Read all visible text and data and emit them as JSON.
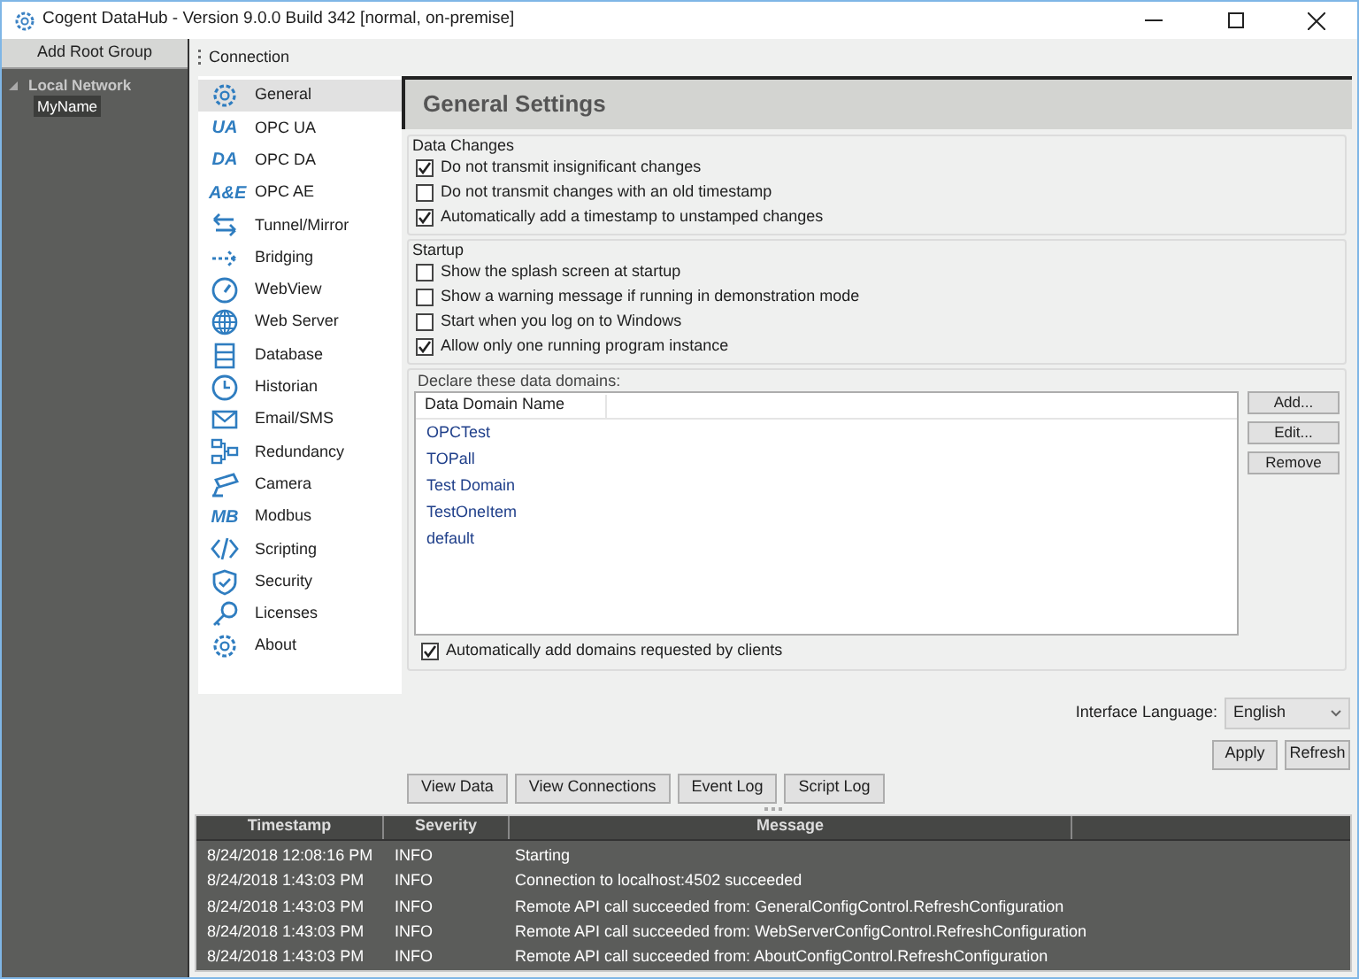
{
  "window": {
    "title": "Cogent DataHub - Version 9.0.0 Build 342 [normal, on-premise]"
  },
  "tree_panel": {
    "add_button": "Add Root Group",
    "nodes": [
      {
        "label": "Local Network",
        "expanded": true,
        "children": [
          {
            "label": "MyName",
            "selected": true
          }
        ]
      }
    ]
  },
  "toolbar": {
    "label": "Connection"
  },
  "nav": [
    {
      "label": "General",
      "kind": "gear",
      "selected": true
    },
    {
      "label": "OPC UA",
      "kind": "text",
      "icon_text": "UA",
      "selected": false
    },
    {
      "label": "OPC DA",
      "kind": "text",
      "icon_text": "DA",
      "selected": false
    },
    {
      "label": "OPC AE",
      "kind": "text",
      "icon_text": "A&E",
      "selected": false
    },
    {
      "label": "Tunnel/Mirror",
      "kind": "swap",
      "selected": false
    },
    {
      "label": "Bridging",
      "kind": "bridge",
      "selected": false
    },
    {
      "label": "WebView",
      "kind": "gauge",
      "selected": false
    },
    {
      "label": "Web Server",
      "kind": "globe",
      "selected": false
    },
    {
      "label": "Database",
      "kind": "database",
      "selected": false
    },
    {
      "label": "Historian",
      "kind": "clock",
      "selected": false
    },
    {
      "label": "Email/SMS",
      "kind": "envelope",
      "selected": false
    },
    {
      "label": "Redundancy",
      "kind": "nodes",
      "selected": false
    },
    {
      "label": "Camera",
      "kind": "camera",
      "selected": false
    },
    {
      "label": "Modbus",
      "kind": "text",
      "icon_text": "MB",
      "selected": false
    },
    {
      "label": "Scripting",
      "kind": "code",
      "selected": false
    },
    {
      "label": "Security",
      "kind": "shield",
      "selected": false
    },
    {
      "label": "Licenses",
      "kind": "key",
      "selected": false
    },
    {
      "label": "About",
      "kind": "gear",
      "selected": false
    }
  ],
  "settings": {
    "title": "General Settings",
    "groups": [
      {
        "legend": "Data Changes",
        "options": [
          {
            "label": "Do not transmit insignificant changes",
            "checked": true
          },
          {
            "label": "Do not transmit changes with an old timestamp",
            "checked": false
          },
          {
            "label": "Automatically add a timestamp to unstamped changes",
            "checked": true
          }
        ]
      },
      {
        "legend": "Startup",
        "options": [
          {
            "label": "Show the splash screen at startup",
            "checked": false
          },
          {
            "label": "Show a warning message if running in demonstration mode",
            "checked": false
          },
          {
            "label": "Start when you log on to Windows",
            "checked": false
          },
          {
            "label": "Allow only one running program instance",
            "checked": true
          }
        ]
      }
    ],
    "domains": {
      "legend": "Declare these data domains:",
      "column": "Data Domain Name",
      "rows": [
        "OPCTest",
        "TOPall",
        "Test Domain",
        "TestOneItem",
        "default"
      ],
      "buttons": [
        "Add...",
        "Edit...",
        "Remove"
      ],
      "auto_add": {
        "label": "Automatically add domains requested by clients",
        "checked": true
      }
    },
    "language": {
      "label": "Interface Language:",
      "value": "English"
    },
    "buttons": [
      "Apply",
      "Refresh"
    ]
  },
  "bottom_buttons": [
    "View Data",
    "View Connections",
    "Event Log",
    "Script Log"
  ],
  "log": {
    "columns": [
      "Timestamp",
      "Severity",
      "Message"
    ],
    "rows": [
      [
        "8/24/2018 12:08:16 PM",
        "INFO",
        "Starting"
      ],
      [
        "8/24/2018 1:43:03 PM",
        "INFO",
        "Connection to localhost:4502 succeeded"
      ],
      [
        "8/24/2018 1:43:03 PM",
        "INFO",
        "Remote API call succeeded from: GeneralConfigControl.RefreshConfiguration"
      ],
      [
        "8/24/2018 1:43:03 PM",
        "INFO",
        "Remote API call succeeded from: WebServerConfigControl.RefreshConfiguration"
      ],
      [
        "8/24/2018 1:43:03 PM",
        "INFO",
        "Remote API call succeeded from: AboutConfigControl.RefreshConfiguration"
      ]
    ]
  }
}
